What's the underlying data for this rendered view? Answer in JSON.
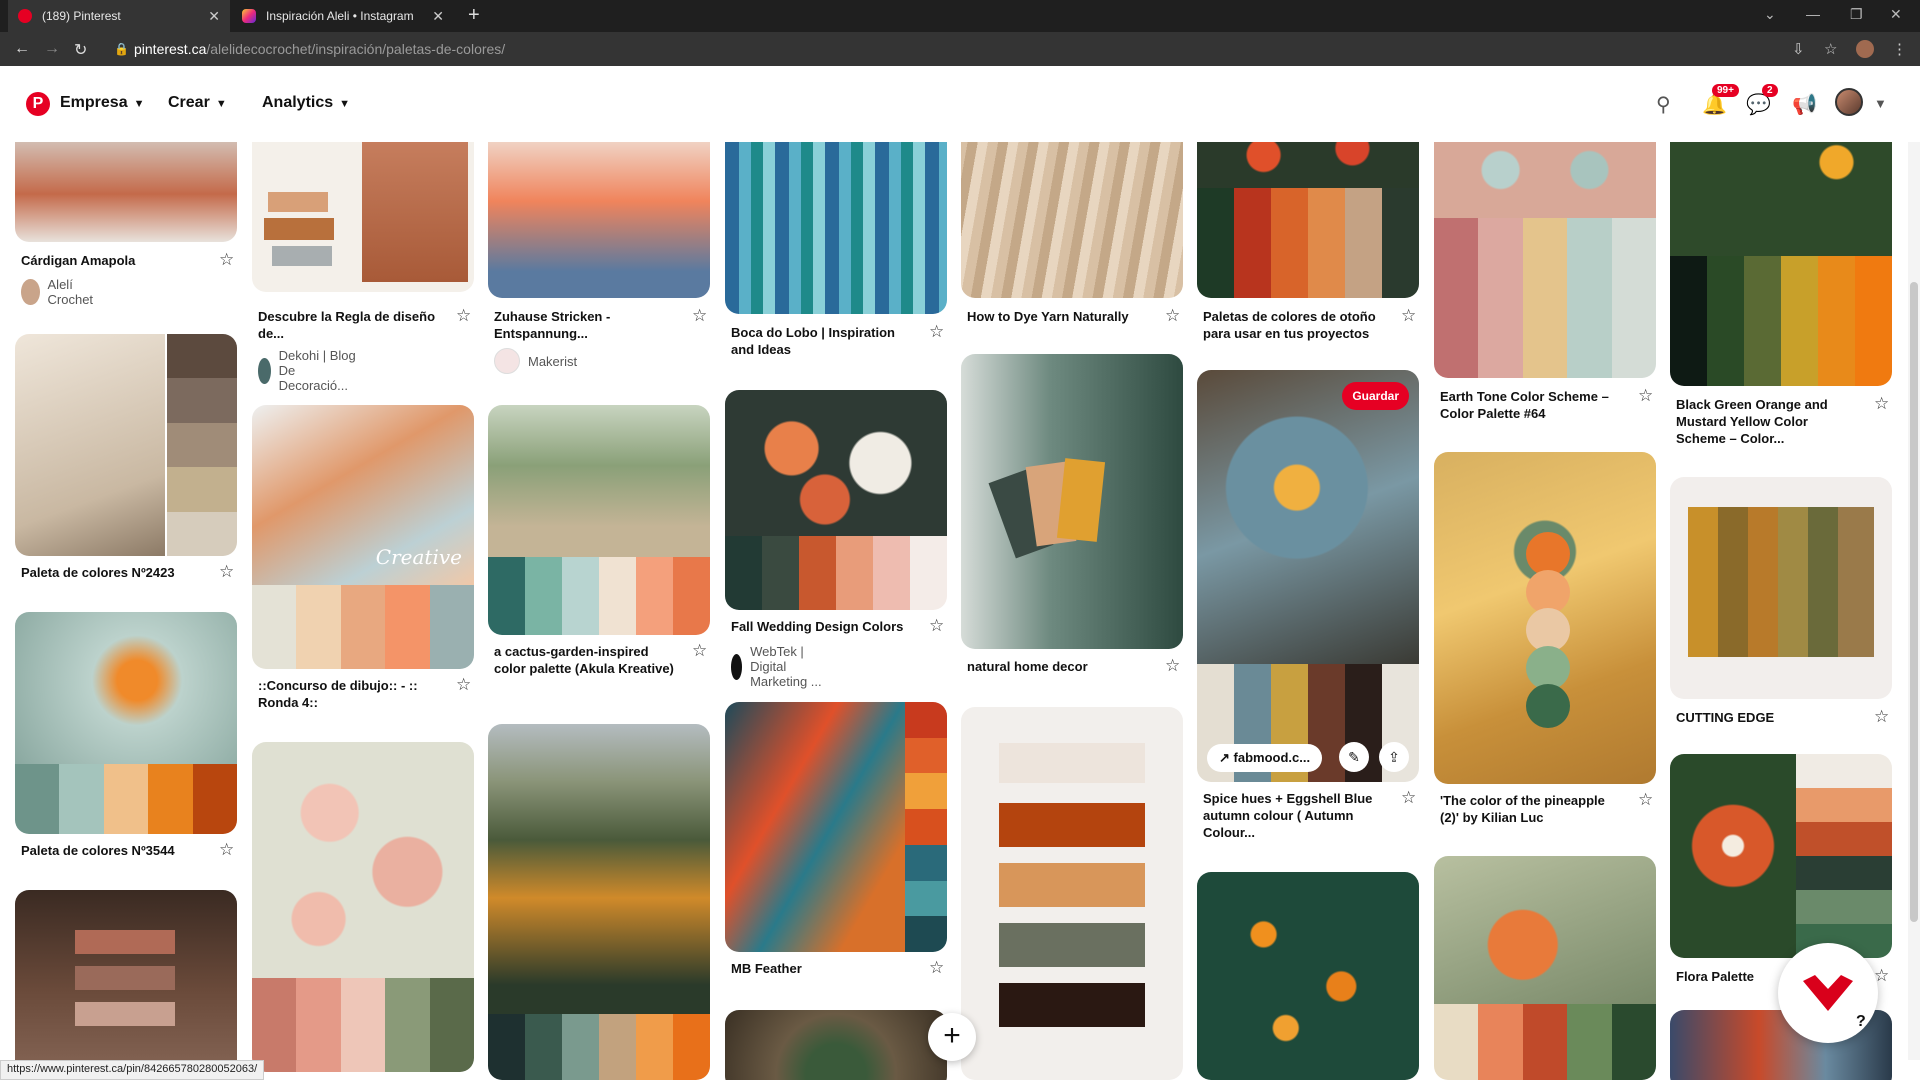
{
  "browser": {
    "tabs": [
      {
        "label": "(189) Pinterest",
        "close": "✕"
      },
      {
        "label": "Inspiración Aleli • Instagram",
        "close": "✕"
      }
    ],
    "new_tab": "+",
    "url_host": "pinterest.ca",
    "url_path": "/alelidecocrochet/inspiración/paletas-de-colores/",
    "status_url": "https://www.pinterest.ca/pin/842665780280052063/"
  },
  "header": {
    "logo": "P",
    "menu": [
      "Empresa",
      "Crear",
      "Analytics"
    ],
    "notifications_badge": "99+",
    "messages_badge": "2"
  },
  "pins": [
    {
      "title": "Cárdigan Amapola",
      "author": "Alelí Crochet"
    },
    {
      "title": "Paleta de colores Nº2423"
    },
    {
      "title": "Paleta de colores Nº3544"
    },
    {
      "title": "Descubre la Regla de diseño de...",
      "author": "Dekohi | Blog De Decoració..."
    },
    {
      "title": "::Concurso de dibujo:: - :: Ronda 4::"
    },
    {
      "title": "Zuhause Stricken - Entspannung...",
      "author": "Makerist"
    },
    {
      "title": "a cactus-garden-inspired color palette (Akula Kreative)"
    },
    {
      "title": "Boca do Lobo | Inspiration and Ideas"
    },
    {
      "title": "Fall Wedding Design Colors",
      "author": "WebTek | Digital Marketing ..."
    },
    {
      "title": "MB Feather"
    },
    {
      "title": "How to Dye Yarn Naturally"
    },
    {
      "title": "natural home decor"
    },
    {
      "title": "Paletas de colores de otoño para usar en tus proyectos"
    },
    {
      "title": "Spice hues + Eggshell Blue autumn colour ( Autumn Colour..."
    },
    {
      "title": "Earth Tone Color Scheme – Color Palette #64"
    },
    {
      "title": "'The color of the pineapple (2)' by Kilian Luc"
    },
    {
      "title": "Black Green Orange and Mustard Yellow Color Scheme – Color..."
    },
    {
      "title": "CUTTING EDGE"
    },
    {
      "title": "Flora Palette"
    }
  ],
  "hover_pin": {
    "save": "Guardar",
    "source": "fabmood.c..."
  },
  "image_text": {
    "creative": "Creative"
  },
  "fab": "+",
  "help": "?"
}
